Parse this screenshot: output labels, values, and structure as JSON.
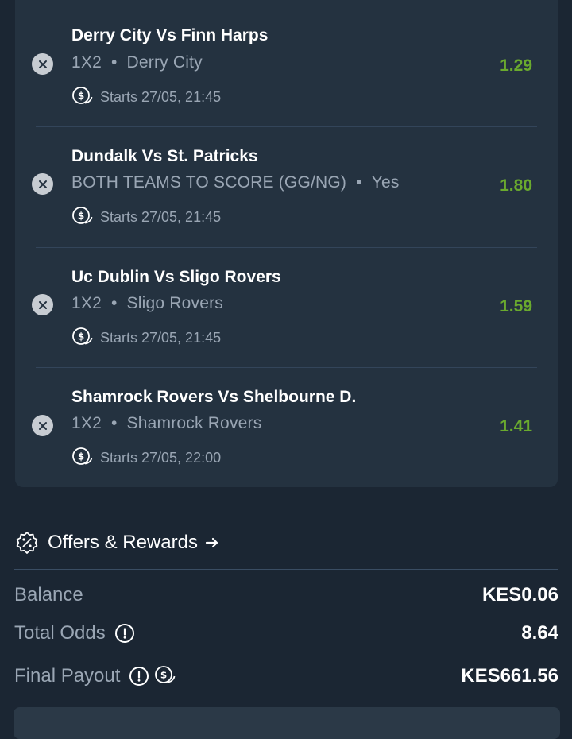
{
  "betslip": {
    "bets": [
      {
        "match": "Derry City Vs Finn Harps",
        "market": "1X2",
        "selection": "Derry City",
        "start": "Starts 27/05, 21:45",
        "odds": "1.29"
      },
      {
        "match": "Dundalk Vs St. Patricks",
        "market": "BOTH TEAMS TO SCORE (GG/NG)",
        "selection": "Yes",
        "start": "Starts 27/05, 21:45",
        "odds": "1.80"
      },
      {
        "match": "Uc Dublin Vs Sligo Rovers",
        "market": "1X2",
        "selection": "Sligo Rovers",
        "start": "Starts 27/05, 21:45",
        "odds": "1.59"
      },
      {
        "match": "Shamrock Rovers Vs Shelbourne D.",
        "market": "1X2",
        "selection": "Shamrock Rovers",
        "start": "Starts 27/05, 22:00",
        "odds": "1.41"
      }
    ],
    "separator": "•"
  },
  "offers": {
    "label": "Offers & Rewards"
  },
  "summary": {
    "balance_label": "Balance",
    "balance_value": "KES0.06",
    "total_odds_label": "Total Odds",
    "total_odds_value": "8.64",
    "final_payout_label": "Final Payout",
    "final_payout_value": "KES661.56"
  },
  "colors": {
    "background": "#1b2633",
    "card": "#243240",
    "odds": "#6aaa2e",
    "muted_text": "#9aa6b4"
  },
  "icons": {
    "remove": "close-icon",
    "start": "cash-coin-icon",
    "offers": "discount-badge-icon",
    "arrow": "arrow-right-icon",
    "info": "info-icon"
  }
}
